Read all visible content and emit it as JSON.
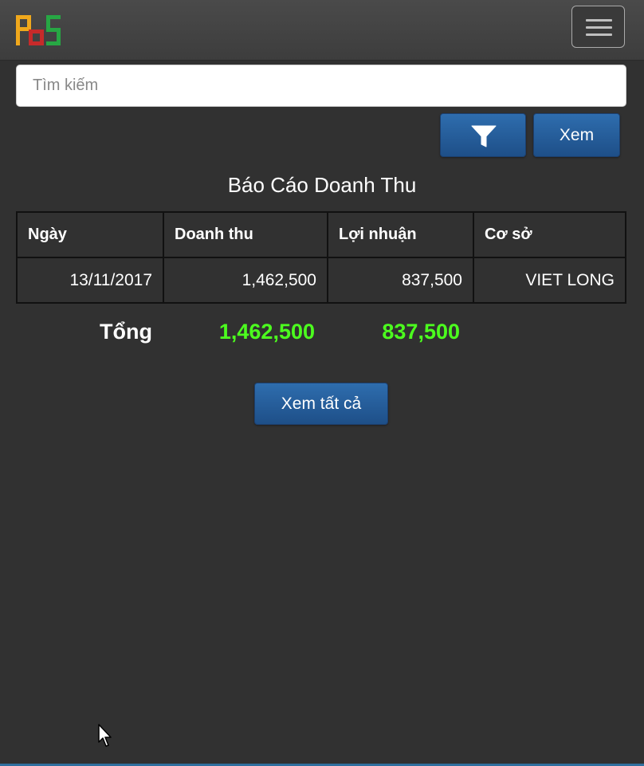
{
  "navbar": {
    "logo_icon": "pbs-logo-icon",
    "menu_icon": "hamburger-menu-icon"
  },
  "search": {
    "placeholder": "Tìm kiếm",
    "value": ""
  },
  "toolbar": {
    "filter_icon": "filter-funnel-icon",
    "view_label": "Xem"
  },
  "report": {
    "title": "Báo Cáo Doanh Thu",
    "columns": [
      "Ngày",
      "Doanh thu",
      "Lợi nhuận",
      "Cơ sở"
    ],
    "rows": [
      [
        "13/11/2017",
        "1,462,500",
        "837,500",
        "VIET LONG"
      ]
    ],
    "totals": {
      "label": "Tổng",
      "revenue": "1,462,500",
      "profit": "837,500"
    },
    "view_all_label": "Xem tất cả"
  },
  "colors": {
    "background": "#313131",
    "accent_button": "#2a5f9e",
    "total_values": "#4cff1e"
  }
}
